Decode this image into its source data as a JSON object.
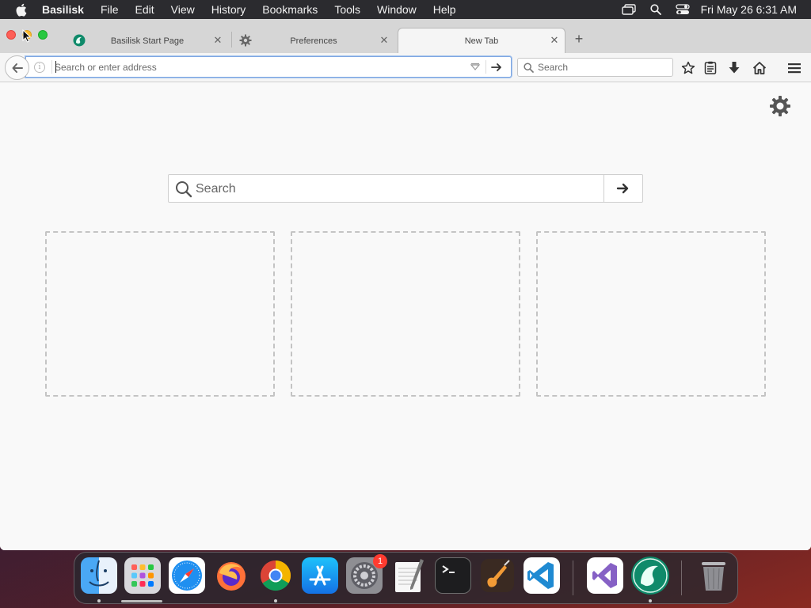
{
  "menubar": {
    "app_name": "Basilisk",
    "items": [
      "File",
      "Edit",
      "View",
      "History",
      "Bookmarks",
      "Tools",
      "Window",
      "Help"
    ],
    "clock": "Fri May 26  6:31 AM",
    "status_icons": [
      "screen-mirroring-icon",
      "spotlight-search-icon",
      "control-center-icon"
    ]
  },
  "tabs": [
    {
      "title": "Basilisk Start Page",
      "icon": "basilisk-logo-icon",
      "active": false
    },
    {
      "title": "Preferences",
      "icon": "gear-icon",
      "active": false
    },
    {
      "title": "New Tab",
      "icon": "",
      "active": true
    }
  ],
  "toolbar": {
    "url_value": "",
    "url_placeholder": "Search or enter address",
    "search_placeholder": "Search"
  },
  "newtab": {
    "search_placeholder": "Search",
    "tiles_count": 3
  },
  "dock": {
    "apps": [
      {
        "name": "Finder",
        "running": true
      },
      {
        "name": "Launchpad",
        "running": false
      },
      {
        "name": "Safari",
        "running": false
      },
      {
        "name": "Firefox",
        "running": false
      },
      {
        "name": "Chrome",
        "running": true
      },
      {
        "name": "App Store",
        "running": false
      },
      {
        "name": "System Preferences",
        "running": false,
        "badge": "1"
      },
      {
        "name": "TextEdit",
        "running": false
      },
      {
        "name": "Terminal",
        "running": false
      },
      {
        "name": "GarageBand",
        "running": false
      },
      {
        "name": "Visual Studio Code",
        "running": false
      },
      {
        "name": "Visual Studio",
        "running": false
      },
      {
        "name": "Basilisk",
        "running": true
      },
      {
        "name": "Trash",
        "running": false
      }
    ]
  },
  "colors": {
    "accent": "#7ea7e2",
    "traffic_close": "#fe5f57",
    "traffic_min": "#febc2e",
    "traffic_max": "#28c840",
    "badge": "#ff3b30"
  }
}
